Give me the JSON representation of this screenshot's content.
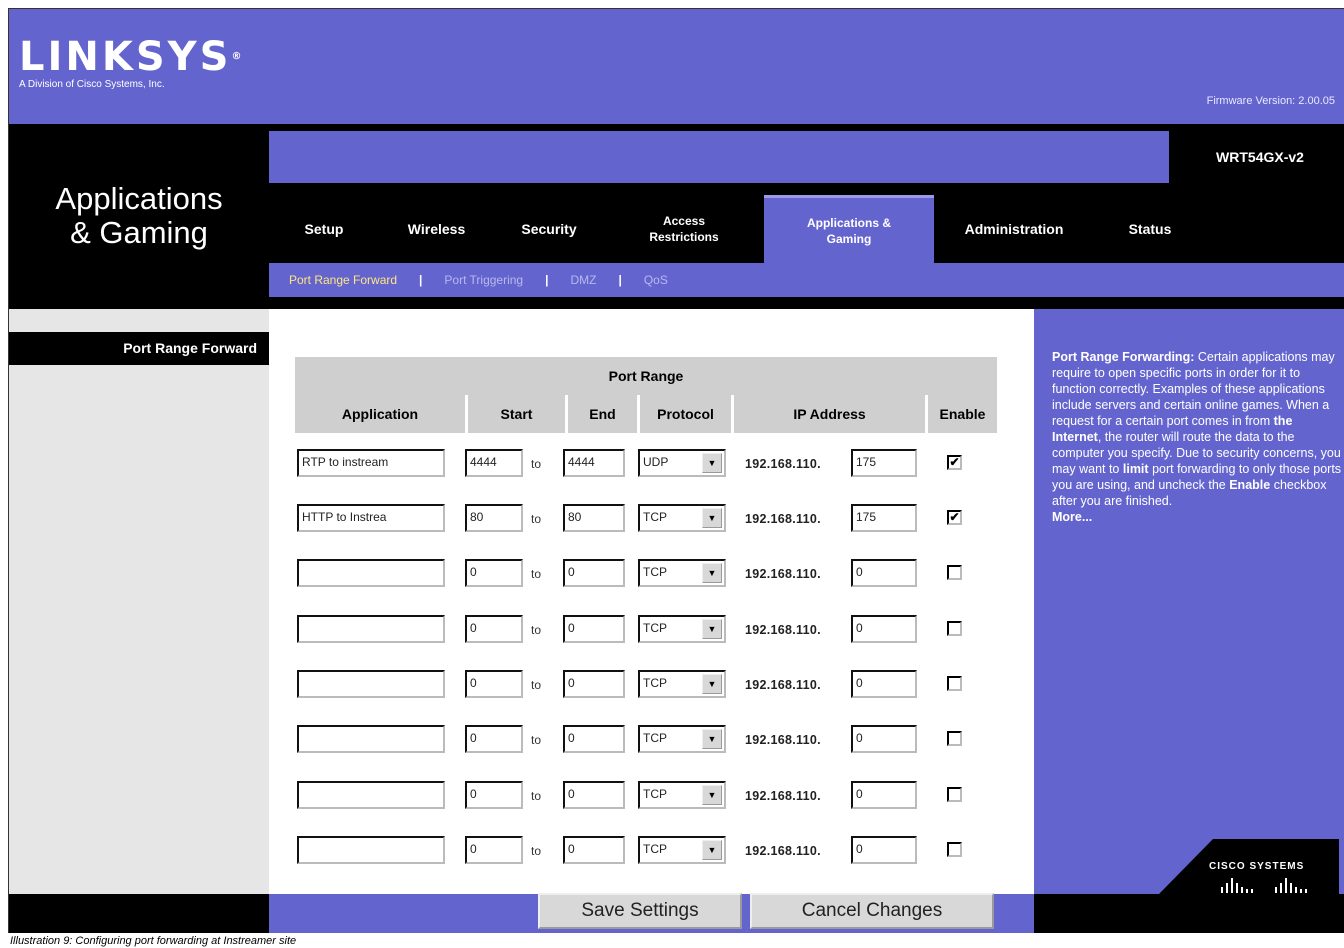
{
  "brand": {
    "logo": "LINKSYS",
    "reg": "®",
    "subtitle": "A Division of Cisco Systems, Inc."
  },
  "firmware": "Firmware Version: 2.00.05",
  "section_title": "Applications & Gaming",
  "model": "WRT54GX-v2",
  "tabs": [
    {
      "label": "Setup",
      "active": false
    },
    {
      "label": "Wireless",
      "active": false
    },
    {
      "label": "Security",
      "active": false
    },
    {
      "label": "Access Restrictions",
      "active": false
    },
    {
      "label": "Applications & Gaming",
      "active": true
    },
    {
      "label": "Administration",
      "active": false
    },
    {
      "label": "Status",
      "active": false
    }
  ],
  "subtabs": [
    "Port Range Forward",
    "Port Triggering",
    "DMZ",
    "QoS"
  ],
  "sidebar_heading": "Port Range Forward",
  "table": {
    "group_header": "Port Range",
    "columns": [
      "Application",
      "Start",
      "End",
      "Protocol",
      "IP Address",
      "Enable"
    ],
    "to_label": "to",
    "ip_prefix": "192.168.110.",
    "rows": [
      {
        "application": "RTP to instream",
        "start": "4444",
        "end": "4444",
        "protocol": "UDP",
        "ip_last": "175",
        "enabled": "✔"
      },
      {
        "application": "HTTP to Instrea",
        "start": "80",
        "end": "80",
        "protocol": "TCP",
        "ip_last": "175",
        "enabled": "✔"
      },
      {
        "application": "",
        "start": "0",
        "end": "0",
        "protocol": "TCP",
        "ip_last": "0",
        "enabled": ""
      },
      {
        "application": "",
        "start": "0",
        "end": "0",
        "protocol": "TCP",
        "ip_last": "0",
        "enabled": ""
      },
      {
        "application": "",
        "start": "0",
        "end": "0",
        "protocol": "TCP",
        "ip_last": "0",
        "enabled": ""
      },
      {
        "application": "",
        "start": "0",
        "end": "0",
        "protocol": "TCP",
        "ip_last": "0",
        "enabled": ""
      },
      {
        "application": "",
        "start": "0",
        "end": "0",
        "protocol": "TCP",
        "ip_last": "0",
        "enabled": ""
      },
      {
        "application": "",
        "start": "0",
        "end": "0",
        "protocol": "TCP",
        "ip_last": "0",
        "enabled": ""
      }
    ]
  },
  "help": {
    "title": "Port Range Forwarding:",
    "p1": "Certain applications may require to open specific ports in order for it to function correctly. Examples of these applications include servers and certain online games. When a request for a certain port comes in from",
    "internet": "the Internet",
    "p2": ", the router will route the data to the computer you specify. Due to security concerns, you may want to",
    "limit": "limit",
    "p3": "port forwarding to only those ports you are using, and uncheck the",
    "enable": "Enable",
    "p4": "checkbox after you are finished.",
    "more": "More..."
  },
  "buttons": {
    "save": "Save Settings",
    "cancel": "Cancel Changes"
  },
  "cisco": "CISCO SYSTEMS",
  "caption": "Illustration 9: Configuring port forwarding at Instreamer site",
  "colors": {
    "brand_purple": "#6464cf",
    "header_black": "#000000",
    "table_header_gray": "#cfcfcf"
  }
}
